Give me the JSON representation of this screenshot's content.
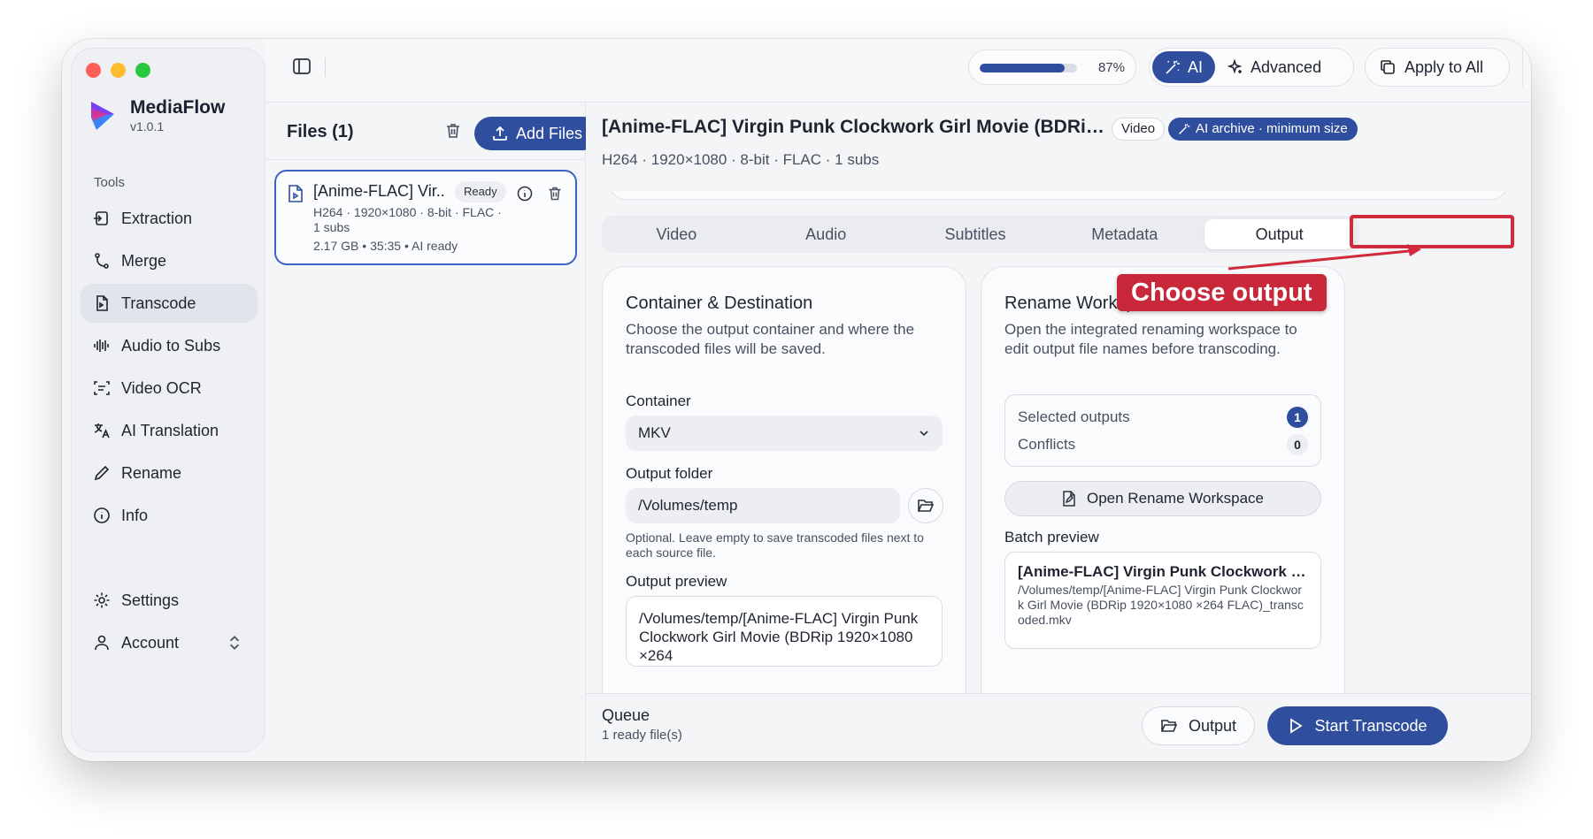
{
  "app": {
    "name": "MediaFlow",
    "version": "v1.0.1"
  },
  "sidebar": {
    "section_label": "Tools",
    "items": [
      {
        "label": "Extraction",
        "icon": "extract-icon"
      },
      {
        "label": "Merge",
        "icon": "merge-icon"
      },
      {
        "label": "Transcode",
        "icon": "transcode-icon",
        "active": true
      },
      {
        "label": "Audio to Subs",
        "icon": "waveform-icon"
      },
      {
        "label": "Video OCR",
        "icon": "scan-text-icon"
      },
      {
        "label": "AI Translation",
        "icon": "translate-icon"
      },
      {
        "label": "Rename",
        "icon": "pen-icon"
      },
      {
        "label": "Info",
        "icon": "info-icon"
      }
    ],
    "bottom": [
      {
        "label": "Settings",
        "icon": "gear-icon"
      },
      {
        "label": "Account",
        "icon": "user-icon"
      }
    ]
  },
  "topbar": {
    "progress_percent": 87,
    "progress_label": "87%",
    "mode_ai": "AI",
    "mode_advanced": "Advanced",
    "apply_all": "Apply to All"
  },
  "files": {
    "title": "Files (1)",
    "add_button": "Add Files",
    "items": [
      {
        "name": "[Anime-FLAC] Vir...",
        "status": "Ready",
        "meta": "H264 · 1920×1080 · 8-bit · FLAC · 1 subs",
        "size": "2.17 GB",
        "duration": "35:35",
        "ai": "AI ready"
      }
    ]
  },
  "main": {
    "title": "[Anime-FLAC] Virgin Punk Clockwork Girl Movie (BDRip 1920×10...",
    "type_badge": "Video",
    "ai_badge": "AI archive · minimum size",
    "subtitle": "H264 · 1920×1080 · 8-bit · FLAC · 1 subs",
    "tabs": [
      "Video",
      "Audio",
      "Subtitles",
      "Metadata",
      "Output"
    ],
    "active_tab": "Output",
    "callout": "Choose output",
    "container_card": {
      "title": "Container & Destination",
      "description": "Choose the output container and where the transcoded files will be saved.",
      "container_label": "Container",
      "container_value": "MKV",
      "folder_label": "Output folder",
      "folder_value": "/Volumes/temp",
      "folder_hint": "Optional. Leave empty to save transcoded files next to each source file.",
      "preview_label": "Output preview",
      "preview_value": "/Volumes/temp/[Anime-FLAC] Virgin Punk Clockwork Girl Movie (BDRip 1920×1080 ×264"
    },
    "rename_card": {
      "title": "Rename Workspace",
      "description": "Open the integrated renaming workspace to edit output file names before transcoding.",
      "selected_label": "Selected outputs",
      "selected_count": "1",
      "conflicts_label": "Conflicts",
      "conflicts_count": "0",
      "open_button": "Open Rename Workspace",
      "batch_label": "Batch preview",
      "batch_name": "[Anime-FLAC] Virgin Punk Clockwork Girl ...",
      "batch_path": "/Volumes/temp/[Anime-FLAC] Virgin Punk Clockwork Girl Movie (BDRip 1920×1080 ×264 FLAC)_transcoded.mkv"
    }
  },
  "footer": {
    "queue_title": "Queue",
    "queue_sub": "1 ready file(s)",
    "output_button": "Output",
    "start_button": "Start Transcode"
  },
  "colors": {
    "accent": "#2f4e9e",
    "callout": "#c8283a"
  }
}
